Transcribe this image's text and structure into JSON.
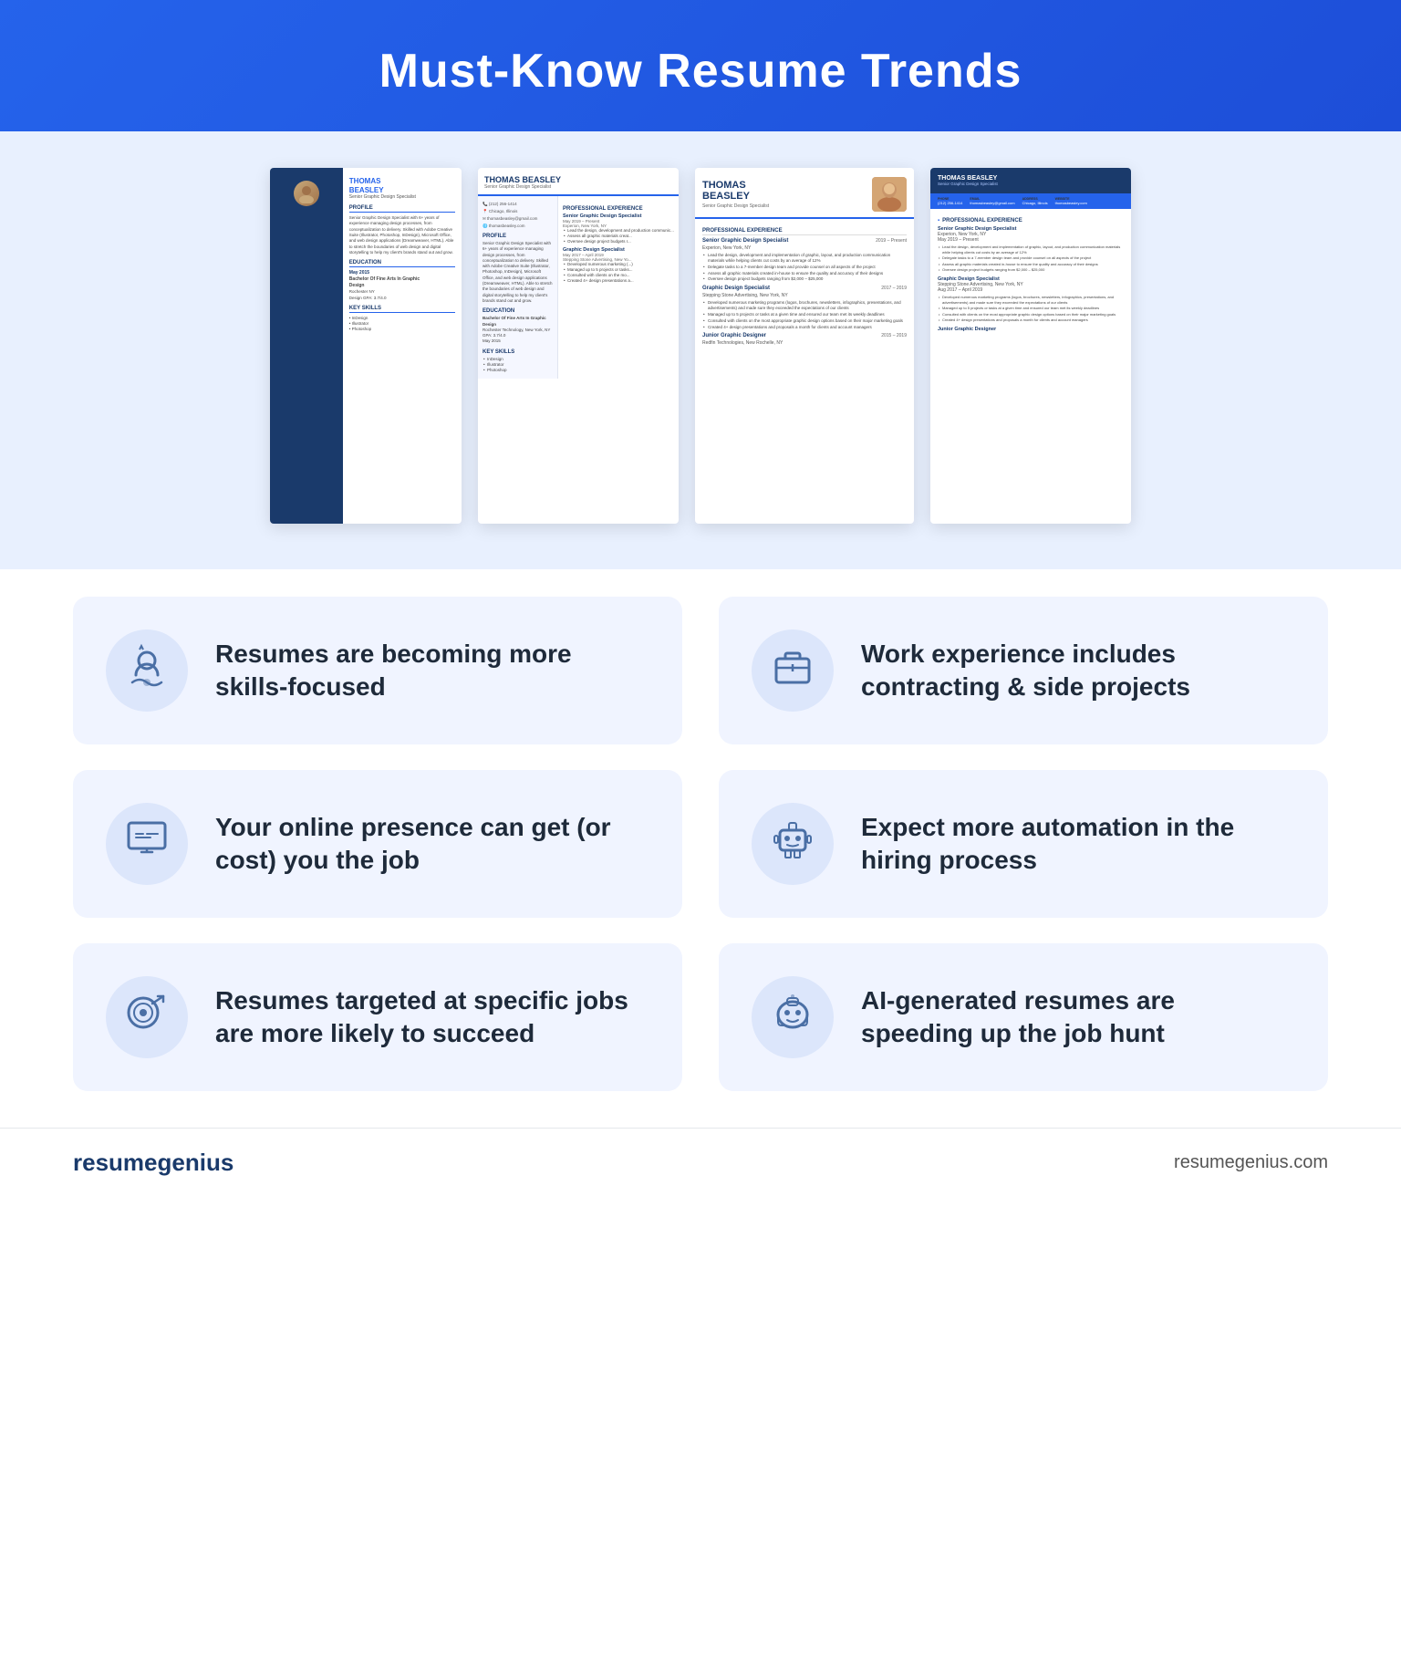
{
  "header": {
    "title": "Must-Know Resume Trends"
  },
  "resumes": {
    "person_name": "THOMAS BEASLEY",
    "person_title": "Senior Graphic Design Specialist",
    "contact": {
      "phone": "(212) 256-1414",
      "location": "Chicago, Illinois",
      "email": "thomasbeasley@gmail.com",
      "website": "thomasbeasley.com"
    },
    "education": {
      "degree": "Bachelor Of Fine Arts In Graphic Design",
      "school": "Rochester Technology, New York, NY",
      "gpa": "GPA: 3.7/4.0",
      "date": "May 2015"
    },
    "skills": [
      "InDesign",
      "Illustrator",
      "Photoshop"
    ],
    "jobs": [
      {
        "title": "Senior Graphic Design Specialist",
        "company": "Experion, New York, NY",
        "dates": "May 2019 – Present",
        "bullets": [
          "Lead the design, development and implementation of graphic, layout, and production communication materials while helping clients cut costs by an average of 12%",
          "Delegate tasks to a 7-member design team and provide counsel on all aspects of the project",
          "Assess all graphic materials created in-house to ensure the quality and accuracy of their designs",
          "Oversee design project budgets ranging from $2,000 – $25,000"
        ]
      },
      {
        "title": "Graphic Design Specialist",
        "company": "Stepping Stone Advertising, New York, NY",
        "dates": "Aug 2017 – April 2019",
        "bullets": [
          "Developed numerous marketing programs (logos, brochures, newsletters, infographics, presentations, and advertisements) and made sure they exceeded the expectations of our clients",
          "Managed up to 5 projects or tasks at a given time and ensured our team met its weekly deadlines",
          "Consulted with clients on the most appropriate graphic design options based on their major marketing goals",
          "Created 4+ design presentations and proposals a month for clients and account managers"
        ]
      },
      {
        "title": "Junior Graphic Designer",
        "company": "Redfin Technologies, New Rochelle, NY",
        "dates": "2015 – 2019"
      }
    ]
  },
  "trends": [
    {
      "id": "skills-focused",
      "icon": "gear-skills",
      "text": "Resumes are becoming more skills-focused"
    },
    {
      "id": "contracting",
      "icon": "briefcase",
      "text": "Work experience includes contracting & side projects"
    },
    {
      "id": "online-presence",
      "icon": "monitor",
      "text": "Your online presence can get (or cost) you the job"
    },
    {
      "id": "automation",
      "icon": "robot",
      "text": "Expect more automation in the hiring process"
    },
    {
      "id": "targeted",
      "icon": "target",
      "text": "Resumes targeted at specific jobs are more likely to succeed"
    },
    {
      "id": "ai-generated",
      "icon": "ai-robot",
      "text": "AI-generated resumes are speeding up the job hunt"
    }
  ],
  "footer": {
    "brand_first": "resume",
    "brand_second": "genius",
    "url": "resumegenius.com"
  }
}
